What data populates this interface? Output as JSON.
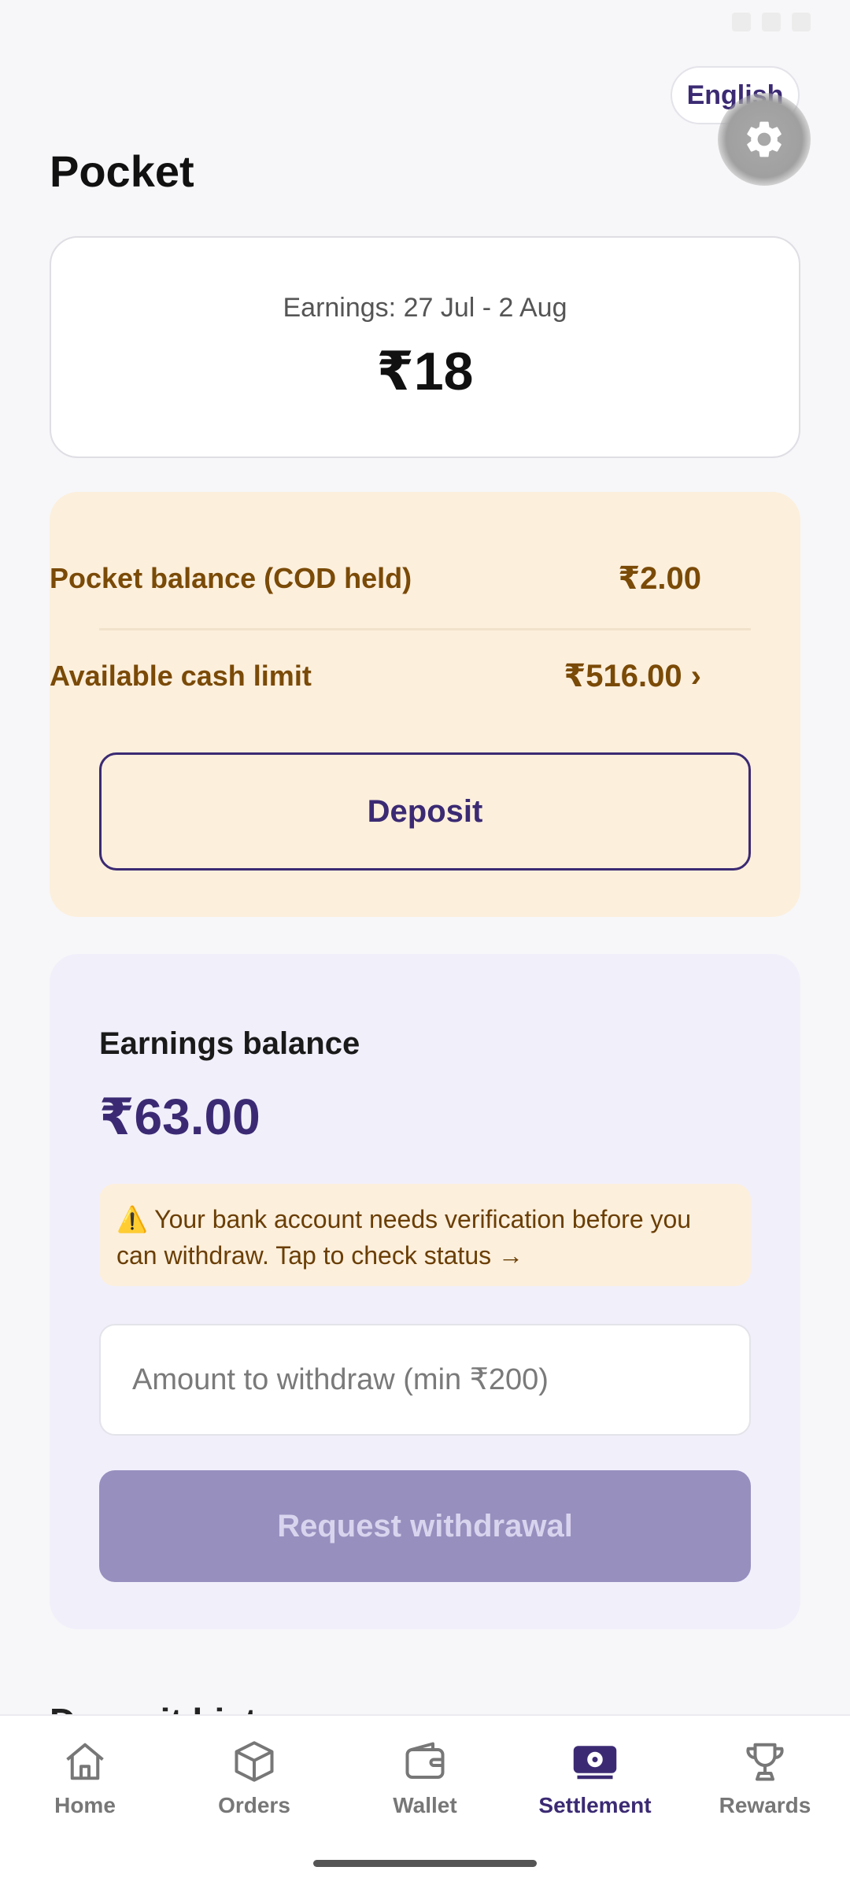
{
  "header": {
    "language_label": "English",
    "page_title": "Pocket"
  },
  "earnings_card": {
    "range_label": "Earnings: 27 Jul - 2 Aug",
    "amount": "₹18"
  },
  "pocket": {
    "balance_label": "Pocket balance (COD held)",
    "balance_value": "₹2.00",
    "cash_limit_label": "Available cash limit",
    "cash_limit_value": "₹516.00 ›",
    "deposit_label": "Deposit"
  },
  "earnings_balance": {
    "title": "Earnings balance",
    "amount": "₹63.00",
    "warning_icon": "⚠️",
    "warning_text": "Your bank account needs verification before you can withdraw. Tap to check status →",
    "withdraw_placeholder": "Amount to withdraw (min ₹200)",
    "request_label": "Request withdrawal"
  },
  "next_section_partial": "Deposit hist",
  "nav": {
    "items": [
      {
        "label": "Home",
        "icon": "home-icon"
      },
      {
        "label": "Orders",
        "icon": "box-icon"
      },
      {
        "label": "Wallet",
        "icon": "wallet-icon"
      },
      {
        "label": "Settlement",
        "icon": "cash-icon"
      },
      {
        "label": "Rewards",
        "icon": "trophy-icon"
      }
    ],
    "active": "Settlement"
  },
  "colors": {
    "brand": "#3b2a73",
    "pocket_bg": "#fcefdc",
    "pocket_text": "#7a4a07",
    "balance_bg": "#f1effa",
    "disabled_button": "#978fbe"
  }
}
